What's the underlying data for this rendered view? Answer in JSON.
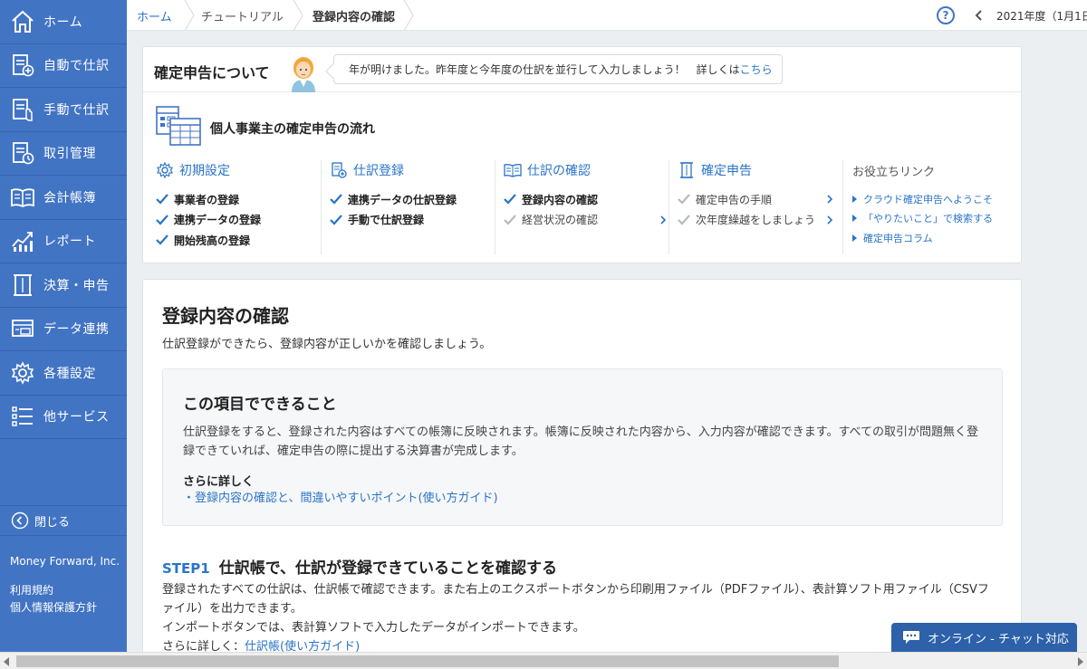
{
  "sidebar": {
    "items": [
      {
        "label": "ホーム",
        "icon": "home-icon"
      },
      {
        "label": "自動で仕訳",
        "icon": "auto-journal-icon"
      },
      {
        "label": "手動で仕訳",
        "icon": "manual-journal-icon"
      },
      {
        "label": "取引管理",
        "icon": "transaction-icon"
      },
      {
        "label": "会計帳簿",
        "icon": "ledger-book-icon"
      },
      {
        "label": "レポート",
        "icon": "report-chart-icon"
      },
      {
        "label": "決算・申告",
        "icon": "tax-return-icon"
      },
      {
        "label": "データ連携",
        "icon": "data-link-icon"
      },
      {
        "label": "各種設定",
        "icon": "gear-icon"
      },
      {
        "label": "他サービス",
        "icon": "list-icon"
      }
    ],
    "close_label": "閉じる",
    "company": "Money Forward, Inc.",
    "terms": "利用規約",
    "privacy": "個人情報保護方針",
    "bg_color": "#4274c4"
  },
  "breadcrumb": {
    "home": "ホーム",
    "tutorial": "チュートリアル",
    "current": "登録内容の確認"
  },
  "topbar": {
    "help": "?",
    "fiscal_year": "2021年度（1月1日"
  },
  "intro": {
    "title": "確定申告について",
    "speech": "年が明けました。昨年度と今年度の仕訳を並行して入力しましょう！　詳しくは",
    "speech_link": "こちら",
    "flow_title": "個人事業主の確定申告の流れ"
  },
  "flow": {
    "columns": [
      {
        "title": "初期設定",
        "items": [
          {
            "label": "事業者の登録",
            "done": true
          },
          {
            "label": "連携データの登録",
            "done": true
          },
          {
            "label": "開始残高の登録",
            "done": true
          }
        ]
      },
      {
        "title": "仕訳登録",
        "items": [
          {
            "label": "連携データの仕訳登録",
            "done": true
          },
          {
            "label": "手動で仕訳登録",
            "done": true
          }
        ]
      },
      {
        "title": "仕訳の確認",
        "items": [
          {
            "label": "登録内容の確認",
            "done": true
          },
          {
            "label": "経営状況の確認",
            "done": false
          }
        ]
      },
      {
        "title": "確定申告",
        "items": [
          {
            "label": "確定申告の手順",
            "done": false
          },
          {
            "label": "次年度繰越をしましょう",
            "done": false
          }
        ]
      }
    ],
    "links_title": "お役立ちリンク",
    "links": [
      "クラウド確定申告へようこそ",
      "「やりたいこと」で検索する",
      "確定申告コラム"
    ],
    "accent": "#2a74c7"
  },
  "main": {
    "title": "登録内容の確認",
    "desc": "仕訳登録ができたら、登録内容が正しいかを確認しましょう。",
    "box_title": "この項目でできること",
    "box_body": "仕訳登録をすると、登録された内容はすべての帳簿に反映されます。帳簿に反映された内容から、入力内容が確認できます。すべての取引が問題無く登録できていれば、確定申告の際に提出する決算書が完成します。",
    "box_more": "さらに詳しく",
    "box_link": "・登録内容の確認と、間違いやすいポイント(使い方ガイド)",
    "step_no": "STEP1",
    "step_title": "仕訳帳で、仕訳が登録できていることを確認する",
    "step_line1": "登録されたすべての仕訳は、仕訳帳で確認できます。また右上のエクスポートボタンから印刷用ファイル（PDFファイル）、表計算ソフト用ファイル（CSVファイル）を出力できます。",
    "step_line2": "インポートボタンでは、表計算ソフトで入力したデータがインポートできます。",
    "step_more": "さらに詳しく：",
    "step_link": "仕訳帳(使い方ガイド)"
  },
  "chat": {
    "label": "オンライン - チャット対応"
  }
}
